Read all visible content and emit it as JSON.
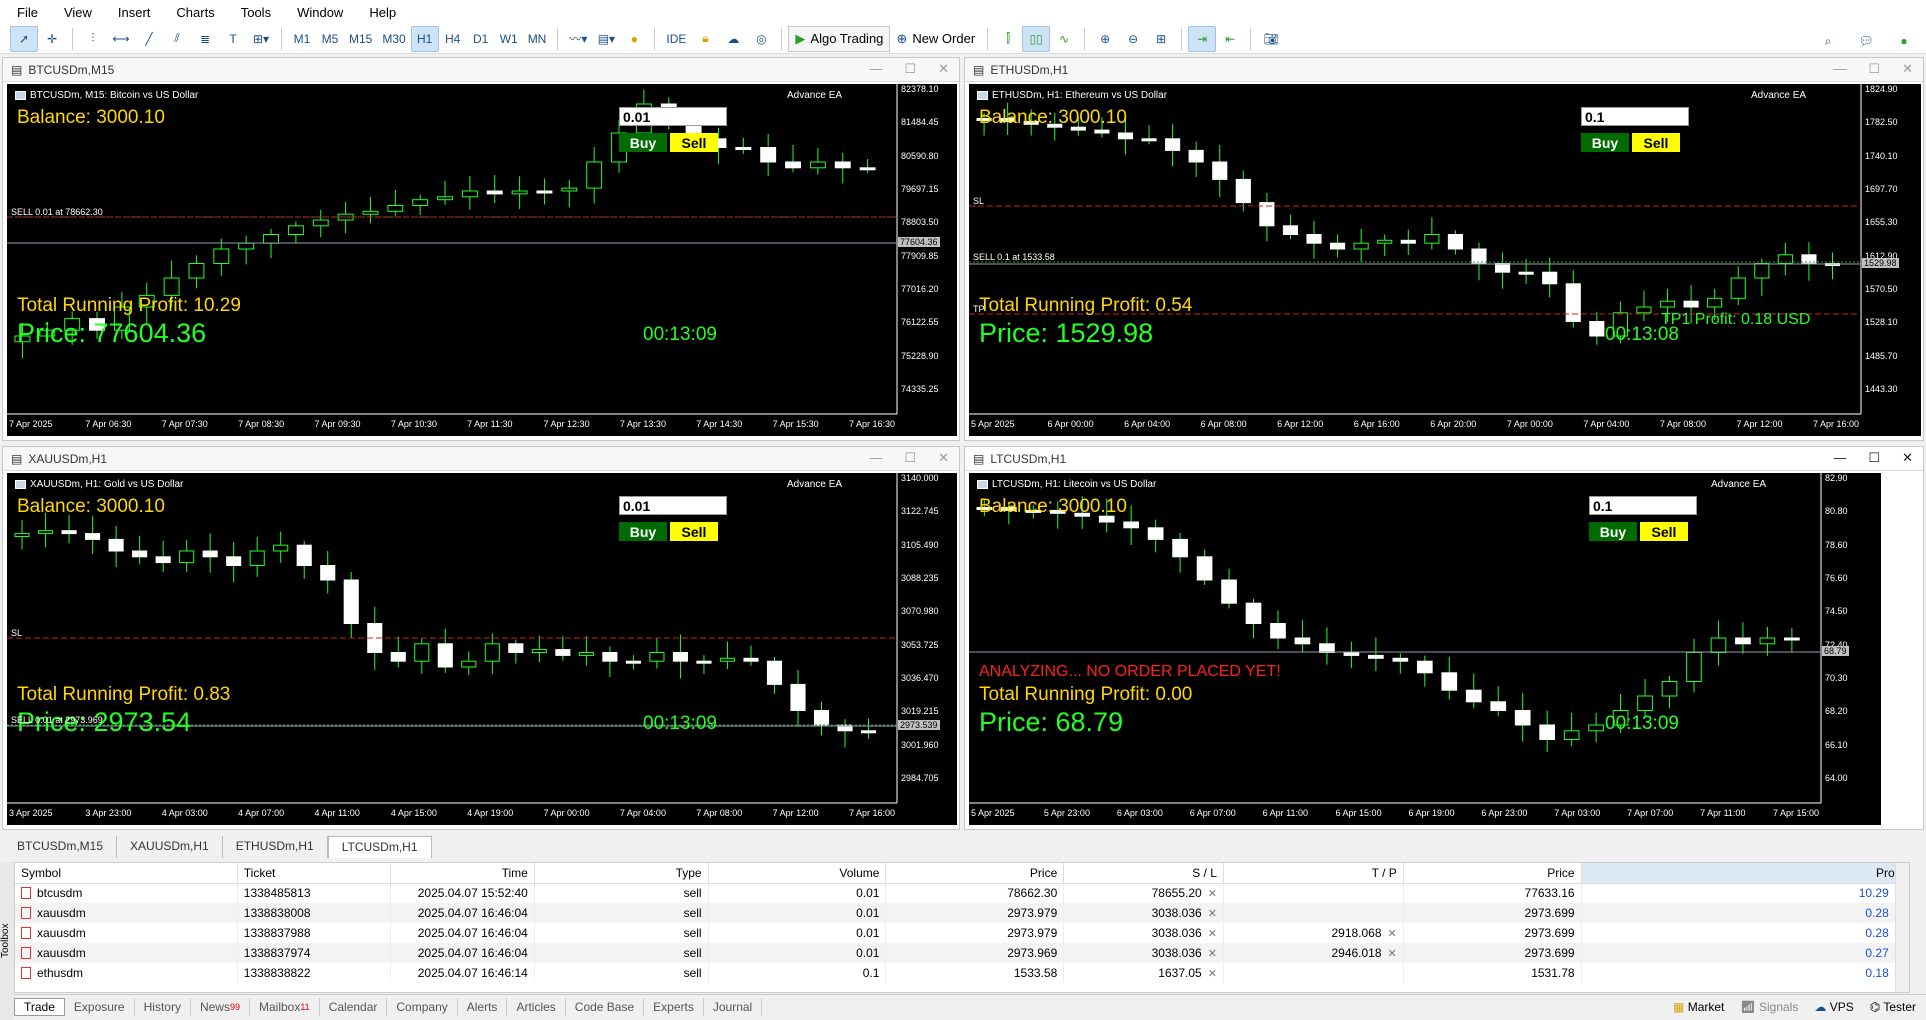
{
  "menu": [
    "File",
    "View",
    "Insert",
    "Charts",
    "Tools",
    "Window",
    "Help"
  ],
  "toolbar": {
    "timeframes": [
      "M1",
      "M5",
      "M15",
      "M30",
      "H1",
      "H4",
      "D1",
      "W1",
      "MN"
    ],
    "active_timeframe": "H1",
    "ide": "IDE",
    "algo_trading": "Algo Trading",
    "new_order": "New Order"
  },
  "windows": [
    {
      "title": "BTCUSDm,M15",
      "header": "BTCUSDm, M15:  Bitcoin vs US Dollar",
      "ea": "Advance EA",
      "balance": "Balance: 3000.10",
      "lot": "0.01",
      "buy": "Buy",
      "sell": "Sell",
      "profit": "Total Running Profit: 10.29",
      "price": "Price: 77604.36",
      "timer": "00:13:09",
      "sell_line": "SELL 0.01 at 78662.30",
      "sl": "",
      "tp": "",
      "warning": "",
      "tp_note": "",
      "price_tag": "77604.36",
      "yticks": [
        "82378.10",
        "81484.45",
        "80590.80",
        "79697.15",
        "78803.50",
        "77909.85",
        "77016.20",
        "76122.55",
        "75228.90",
        "74335.25"
      ],
      "xticks": [
        "7 Apr 2025",
        "7 Apr 06:30",
        "7 Apr 07:30",
        "7 Apr 08:30",
        "7 Apr 09:30",
        "7 Apr 10:30",
        "7 Apr 11:30",
        "7 Apr 12:30",
        "7 Apr 13:30",
        "7 Apr 14:30",
        "7 Apr 15:30",
        "7 Apr 16:30"
      ]
    },
    {
      "title": "ETHUSDm,H1",
      "header": "ETHUSDm, H1:  Ethereum vs US Dollar",
      "ea": "Advance EA",
      "balance": "Balance: 3000.10",
      "lot": "0.1",
      "buy": "Buy",
      "sell": "Sell",
      "profit": "Total Running Profit: 0.54",
      "price": "Price: 1529.98",
      "timer": "00:13:08",
      "sell_line": "SELL 0.1 at 1533.58",
      "sl": "SL",
      "tp": "TP",
      "warning": "",
      "tp_note": "TP1 Profit: 0.18 USD",
      "price_tag": "1529.98",
      "yticks": [
        "1824.90",
        "1782.50",
        "1740.10",
        "1697.70",
        "1655.30",
        "1612.90",
        "1570.50",
        "1528.10",
        "1485.70",
        "1443.30"
      ],
      "xticks": [
        "5 Apr 2025",
        "6 Apr 00:00",
        "6 Apr 04:00",
        "6 Apr 08:00",
        "6 Apr 12:00",
        "6 Apr 16:00",
        "6 Apr 20:00",
        "7 Apr 00:00",
        "7 Apr 04:00",
        "7 Apr 08:00",
        "7 Apr 12:00",
        "7 Apr 16:00"
      ]
    },
    {
      "title": "XAUUSDm,H1",
      "header": "XAUUSDm, H1:  Gold vs US Dollar",
      "ea": "Advance EA",
      "balance": "Balance: 3000.10",
      "lot": "0.01",
      "buy": "Buy",
      "sell": "Sell",
      "profit": "Total Running Profit: 0.83",
      "price": "Price: 2973.54",
      "timer": "00:13:09",
      "sell_line": "SELL 0.01 at 2973.969",
      "sl": "SL",
      "tp": "",
      "warning": "",
      "tp_note": "",
      "price_tag": "2973.539",
      "yticks": [
        "3140.000",
        "3122.745",
        "3105.490",
        "3088.235",
        "3070.980",
        "3053.725",
        "3036.470",
        "3019.215",
        "3001.960",
        "2984.705"
      ],
      "xticks": [
        "3 Apr 2025",
        "3 Apr 23:00",
        "4 Apr 03:00",
        "4 Apr 07:00",
        "4 Apr 11:00",
        "4 Apr 15:00",
        "4 Apr 19:00",
        "7 Apr 00:00",
        "7 Apr 04:00",
        "7 Apr 08:00",
        "7 Apr 12:00",
        "7 Apr 16:00"
      ]
    },
    {
      "title": "LTCUSDm,H1",
      "header": "LTCUSDm, H1:  Litecoin vs US Dollar",
      "ea": "Advance EA",
      "balance": "Balance: 3000.10",
      "lot": "0.1",
      "buy": "Buy",
      "sell": "Sell",
      "profit": "Total Running Profit: 0.00",
      "price": "Price: 68.79",
      "timer": "00:13:09",
      "sell_line": "",
      "sl": "",
      "tp": "",
      "warning": "ANALYZING... NO ORDER PLACED YET!",
      "tp_note": "",
      "price_tag": "68.79",
      "yticks": [
        "82.90",
        "80.80",
        "78.60",
        "76.60",
        "74.50",
        "72.40",
        "70.30",
        "68.20",
        "66.10",
        "64.00"
      ],
      "xticks": [
        "5 Apr 2025",
        "5 Apr 23:00",
        "6 Apr 03:00",
        "6 Apr 07:00",
        "6 Apr 11:00",
        "6 Apr 15:00",
        "6 Apr 19:00",
        "6 Apr 23:00",
        "7 Apr 03:00",
        "7 Apr 07:00",
        "7 Apr 11:00",
        "7 Apr 15:00"
      ]
    }
  ],
  "chart_tabs": [
    "BTCUSDm,M15",
    "XAUUSDm,H1",
    "ETHUSDm,H1",
    "LTCUSDm,H1"
  ],
  "active_chart_tab": "LTCUSDm,H1",
  "trade_table": {
    "headers": [
      "Symbol",
      "Ticket",
      "Time",
      "Type",
      "Volume",
      "Price",
      "S / L",
      "T / P",
      "Price",
      "Profit"
    ],
    "rows": [
      [
        "btcusdm",
        "1338485813",
        "2025.04.07 15:52:40",
        "sell",
        "0.01",
        "78662.30",
        "78655.20",
        "",
        "77633.16",
        "10.29"
      ],
      [
        "xauusdm",
        "1338838008",
        "2025.04.07 16:46:04",
        "sell",
        "0.01",
        "2973.979",
        "3038.036",
        "",
        "2973.699",
        "0.28"
      ],
      [
        "xauusdm",
        "1338837988",
        "2025.04.07 16:46:04",
        "sell",
        "0.01",
        "2973.979",
        "3038.036",
        "2918.068",
        "2973.699",
        "0.28"
      ],
      [
        "xauusdm",
        "1338837974",
        "2025.04.07 16:46:04",
        "sell",
        "0.01",
        "2973.969",
        "3038.036",
        "2946.018",
        "2973.699",
        "0.27"
      ],
      [
        "ethusdm",
        "1338838822",
        "2025.04.07 16:46:14",
        "sell",
        "0.1",
        "1533.58",
        "1637.05",
        "",
        "1531.78",
        "0.18"
      ]
    ]
  },
  "toolbox_label": "Toolbox",
  "bottom_tabs": [
    {
      "label": "Trade",
      "badge": ""
    },
    {
      "label": "Exposure",
      "badge": ""
    },
    {
      "label": "History",
      "badge": ""
    },
    {
      "label": "News",
      "badge": "99"
    },
    {
      "label": "Mailbox",
      "badge": "11"
    },
    {
      "label": "Calendar",
      "badge": ""
    },
    {
      "label": "Company",
      "badge": ""
    },
    {
      "label": "Alerts",
      "badge": ""
    },
    {
      "label": "Articles",
      "badge": ""
    },
    {
      "label": "Code Base",
      "badge": ""
    },
    {
      "label": "Experts",
      "badge": ""
    },
    {
      "label": "Journal",
      "badge": ""
    }
  ],
  "status_right": [
    "Market",
    "Signals",
    "VPS",
    "Tester"
  ],
  "colors": {
    "chart_bg": "#000000",
    "bull": "#22ff22",
    "balance": "#ffd800",
    "sell_btn": "#ffff00",
    "buy_btn": "#006b00",
    "warn": "#ff2020",
    "profit_blue": "#1a4fd6"
  }
}
